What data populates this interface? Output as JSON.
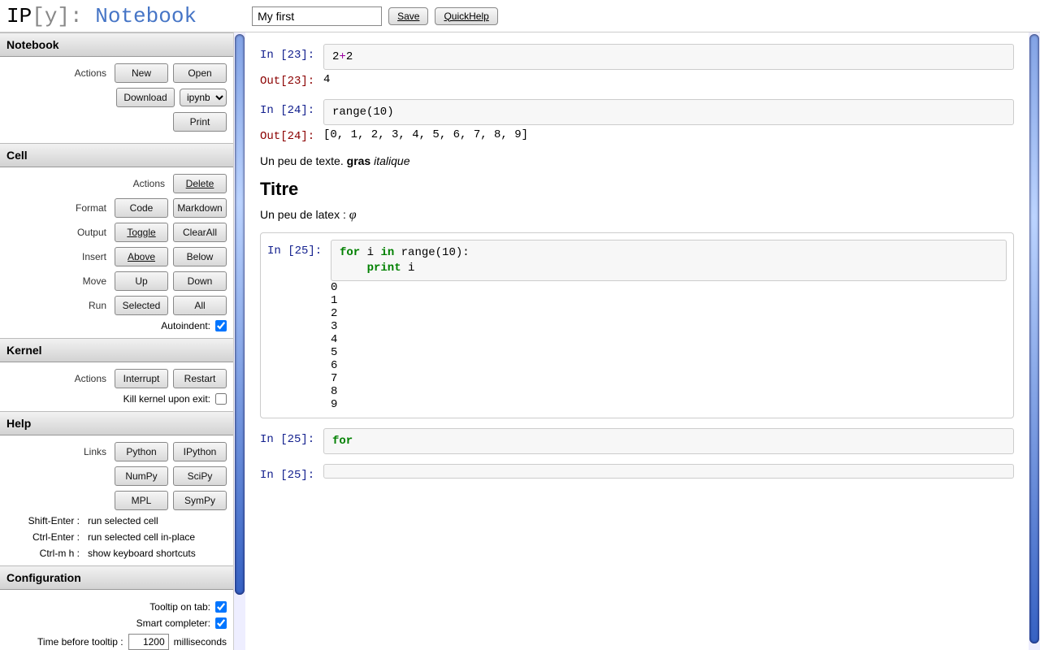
{
  "header": {
    "title_value": "My first",
    "save_label": "Save",
    "quickhelp_label": "QuickHelp"
  },
  "logo": {
    "ip": "IP",
    "y": "[y]:",
    "notebook": " Notebook"
  },
  "sidebar": {
    "notebook": {
      "title": "Notebook",
      "actions_label": "Actions",
      "new": "New",
      "open": "Open",
      "download": "Download",
      "format_selected": "ipynb",
      "print": "Print"
    },
    "cell": {
      "title": "Cell",
      "actions_label": "Actions",
      "delete": "Delete",
      "format_label": "Format",
      "code": "Code",
      "markdown": "Markdown",
      "output_label": "Output",
      "toggle": "Toggle",
      "clearall": "ClearAll",
      "insert_label": "Insert",
      "above": "Above",
      "below": "Below",
      "move_label": "Move",
      "up": "Up",
      "down": "Down",
      "run_label": "Run",
      "selected": "Selected",
      "all": "All",
      "autoindent_label": "Autoindent:",
      "autoindent_checked": true
    },
    "kernel": {
      "title": "Kernel",
      "actions_label": "Actions",
      "interrupt": "Interrupt",
      "restart": "Restart",
      "killexit_label": "Kill kernel upon exit:",
      "killexit_checked": false
    },
    "help": {
      "title": "Help",
      "links_label": "Links",
      "python": "Python",
      "ipython": "IPython",
      "numpy": "NumPy",
      "scipy": "SciPy",
      "mpl": "MPL",
      "sympy": "SymPy",
      "shortcuts": [
        {
          "key": "Shift-Enter :",
          "desc": "run selected cell"
        },
        {
          "key": "Ctrl-Enter :",
          "desc": "run selected cell in-place"
        },
        {
          "key": "Ctrl-m h :",
          "desc": "show keyboard shortcuts"
        }
      ]
    },
    "config": {
      "title": "Configuration",
      "tooltip_tab_label": "Tooltip on tab:",
      "tooltip_tab_checked": true,
      "smart_completer_label": "Smart completer:",
      "smart_completer_checked": true,
      "time_before_tooltip_label": "Time before tooltip :",
      "time_before_tooltip_value": "1200",
      "time_unit": "milliseconds"
    }
  },
  "cells": {
    "c23_in_prompt": "In [23]:",
    "c23_code_pre": "2",
    "c23_code_op": "+",
    "c23_code_post": "2",
    "c23_out_prompt": "Out[23]:",
    "c23_out": "4",
    "c24_in_prompt": "In [24]:",
    "c24_code": "range(10)",
    "c24_out_prompt": "Out[24]:",
    "c24_out": "[0, 1, 2, 3, 4, 5, 6, 7, 8, 9]",
    "md_text_pre": "Un peu de texte. ",
    "md_bold": "gras",
    "md_space": " ",
    "md_italic": "italique",
    "md_title": "Titre",
    "latex_text": "Un peu de latex : ",
    "latex_sym": "φ",
    "c25_in_prompt": "In [25]:",
    "c25_for": "for",
    "c25_var": " i ",
    "c25_in": "in",
    "c25_rest": " range(10):",
    "c25_print": "    print",
    "c25_printvar": " i",
    "c25_stream": "0\n1\n2\n3\n4\n5\n6\n7\n8\n9",
    "c25b_in_prompt": "In [25]:",
    "c25b_code": "for",
    "c25c_in_prompt": "In [25]:",
    "c25c_code": ""
  }
}
